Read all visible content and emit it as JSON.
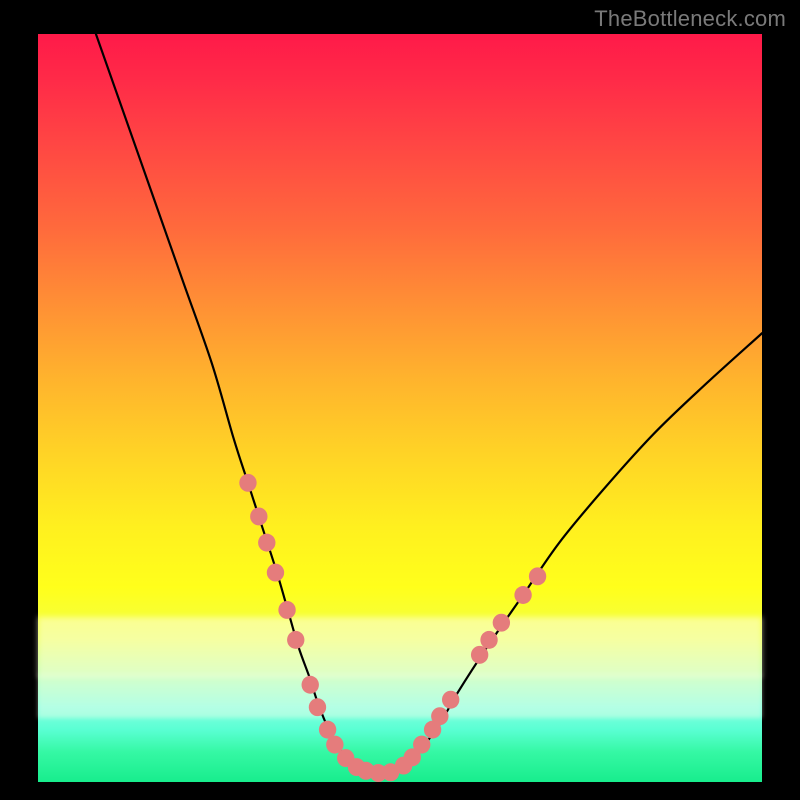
{
  "watermark": "TheBottleneck.com",
  "chart_data": {
    "type": "line",
    "title": "",
    "xlabel": "",
    "ylabel": "",
    "xlim": [
      0,
      100
    ],
    "ylim": [
      0,
      100
    ],
    "grid": false,
    "series": [
      {
        "name": "curve",
        "color": "#000000",
        "x": [
          8,
          12,
          16,
          20,
          24,
          27,
          29,
          31,
          33,
          34.5,
          36,
          37.5,
          38.5,
          39.7,
          41,
          42.3,
          44,
          46,
          47.5,
          50,
          52,
          55,
          58,
          62,
          67,
          72,
          78,
          85,
          92,
          100
        ],
        "y": [
          100,
          89,
          78,
          67,
          56,
          46,
          40,
          34,
          28,
          23,
          18,
          14,
          11,
          8,
          5.5,
          3.5,
          2,
          1.2,
          1.2,
          2,
          3.6,
          7,
          12,
          18,
          25,
          32,
          39,
          46.5,
          53,
          60
        ]
      }
    ],
    "markers": {
      "name": "dots",
      "color": "#e57c7c",
      "radius_frac": 0.012,
      "points": [
        {
          "x": 29.0,
          "y": 40.0
        },
        {
          "x": 30.5,
          "y": 35.5
        },
        {
          "x": 31.6,
          "y": 32.0
        },
        {
          "x": 32.8,
          "y": 28.0
        },
        {
          "x": 34.4,
          "y": 23.0
        },
        {
          "x": 35.6,
          "y": 19.0
        },
        {
          "x": 37.6,
          "y": 13.0
        },
        {
          "x": 38.6,
          "y": 10.0
        },
        {
          "x": 40.0,
          "y": 7.0
        },
        {
          "x": 41.0,
          "y": 5.0
        },
        {
          "x": 42.5,
          "y": 3.2
        },
        {
          "x": 44.0,
          "y": 2.0
        },
        {
          "x": 45.3,
          "y": 1.5
        },
        {
          "x": 47.0,
          "y": 1.2
        },
        {
          "x": 48.7,
          "y": 1.3
        },
        {
          "x": 50.5,
          "y": 2.2
        },
        {
          "x": 51.7,
          "y": 3.3
        },
        {
          "x": 53.0,
          "y": 5.0
        },
        {
          "x": 54.5,
          "y": 7.0
        },
        {
          "x": 55.5,
          "y": 8.8
        },
        {
          "x": 57.0,
          "y": 11.0
        },
        {
          "x": 61.0,
          "y": 17.0
        },
        {
          "x": 62.3,
          "y": 19.0
        },
        {
          "x": 64.0,
          "y": 21.3
        },
        {
          "x": 67.0,
          "y": 25.0
        },
        {
          "x": 69.0,
          "y": 27.5
        }
      ]
    }
  }
}
